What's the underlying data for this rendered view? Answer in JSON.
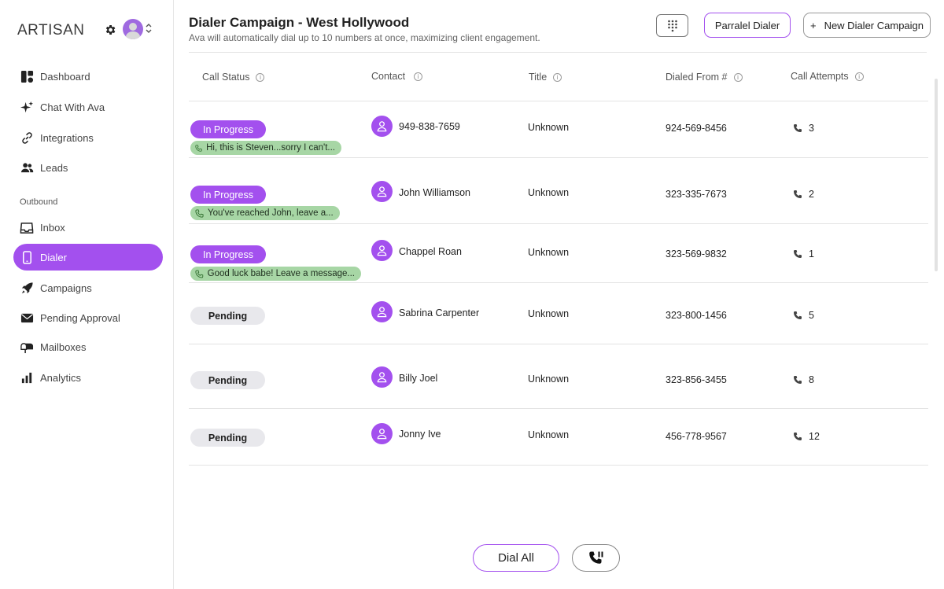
{
  "app": {
    "brand": "ARTISAN"
  },
  "sidebar": {
    "section_label": "Outbound",
    "items": [
      {
        "label": "Dashboard",
        "icon": "dashboard-icon"
      },
      {
        "label": "Chat With Ava",
        "icon": "sparkle-icon"
      },
      {
        "label": "Integrations",
        "icon": "link-icon"
      },
      {
        "label": "Leads",
        "icon": "people-icon"
      },
      {
        "label": "Inbox",
        "icon": "inbox-icon"
      },
      {
        "label": "Dialer",
        "icon": "phone-device-icon",
        "active": true
      },
      {
        "label": "Campaigns",
        "icon": "rocket-icon"
      },
      {
        "label": "Pending Approval",
        "icon": "envelope-icon"
      },
      {
        "label": "Mailboxes",
        "icon": "mailbox-icon"
      },
      {
        "label": "Analytics",
        "icon": "bar-chart-icon"
      }
    ]
  },
  "header": {
    "title": "Dialer Campaign - West Hollywood",
    "subtitle": "Ava will automatically dial up to 10 numbers at once, maximizing client engagement.",
    "parallel_label": "Parralel Dialer",
    "new_campaign_label": "New Dialer Campaign",
    "new_campaign_plus": "+"
  },
  "table": {
    "columns": [
      "Call Status",
      "Contact",
      "Title",
      "Dialed From #",
      "Call Attempts"
    ],
    "info_glyph": "i",
    "rows": [
      {
        "status": "In Progress",
        "snippet": "Hi, this is Steven...sorry I can't...",
        "contact": "949-838-7659",
        "title": "Unknown",
        "from": "924-569-8456",
        "attempts": "3"
      },
      {
        "status": "In Progress",
        "snippet": "You've reached John, leave a...",
        "contact": "John Williamson",
        "title": "Unknown",
        "from": "323-335-7673",
        "attempts": "2"
      },
      {
        "status": "In Progress",
        "snippet": "Good luck babe! Leave a message...",
        "contact": "Chappel Roan",
        "title": "Unknown",
        "from": "323-569-9832",
        "attempts": "1"
      },
      {
        "status": "Pending",
        "snippet": "",
        "contact": "Sabrina Carpenter",
        "title": "Unknown",
        "from": "323-800-1456",
        "attempts": "5"
      },
      {
        "status": "Pending",
        "snippet": "",
        "contact": "Billy Joel",
        "title": "Unknown",
        "from": "323-856-3455",
        "attempts": "8"
      },
      {
        "status": "Pending",
        "snippet": "",
        "contact": "Jonny Ive",
        "title": "Unknown",
        "from": "456-778-9567",
        "attempts": "12"
      }
    ]
  },
  "footer": {
    "dial_all_label": "Dial All"
  },
  "colors": {
    "accent": "#a350ee",
    "snippet_bg": "#a7d6a5",
    "pending_bg": "#e8e8ec"
  }
}
